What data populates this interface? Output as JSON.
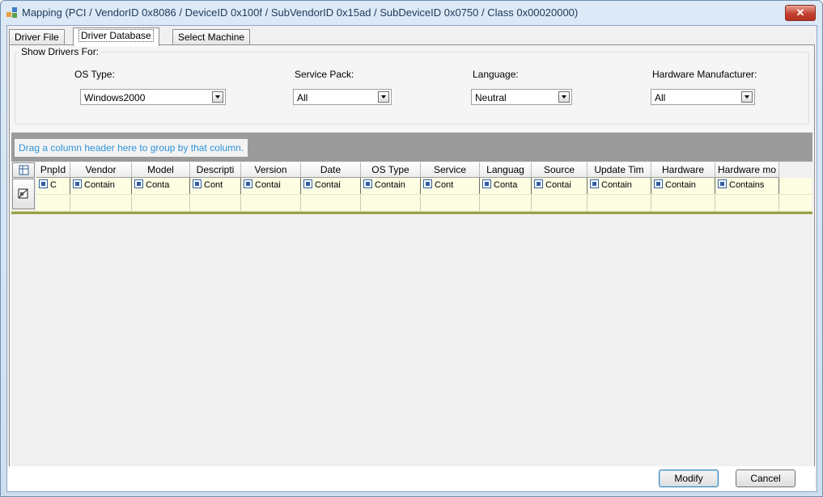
{
  "window": {
    "title": "Mapping (PCI / VendorID 0x8086 / DeviceID 0x100f / SubVendorID 0x15ad / SubDeviceID 0x0750 / Class 0x00020000)",
    "close_label": "✕"
  },
  "tabs": [
    {
      "label": "Driver File"
    },
    {
      "label": "Driver Database"
    },
    {
      "label": "Select Machine"
    }
  ],
  "filters": {
    "group_label": "Show Drivers For:",
    "os_type": {
      "label": "OS Type:",
      "value": "Windows2000"
    },
    "service_pack": {
      "label": "Service Pack:",
      "value": "All"
    },
    "language": {
      "label": "Language:",
      "value": "Neutral"
    },
    "hardware_manufacturer": {
      "label": "Hardware Manufacturer:",
      "value": "All"
    }
  },
  "grid": {
    "group_hint": "Drag a column header here to group by that column.",
    "columns": [
      "PnpId",
      "Vendor",
      "Model",
      "Descripti",
      "Version",
      "Date",
      "OS Type",
      "Service",
      "Languag",
      "Source",
      "Update Tim",
      "Hardware",
      "Hardware mo"
    ],
    "filter_operators": [
      "C",
      "Contain",
      "Conta",
      "Cont",
      "Contai",
      "Contai",
      "Contain",
      "Cont",
      "Conta",
      "Contai",
      "Contain",
      "Contain",
      "Contains"
    ]
  },
  "footer": {
    "modify_label": "Modify",
    "cancel_label": "Cancel"
  },
  "colors": {
    "filter_row_bg": "#fdfde2",
    "group_hint_text": "#2f93d8",
    "close_button": "#c4402e"
  }
}
